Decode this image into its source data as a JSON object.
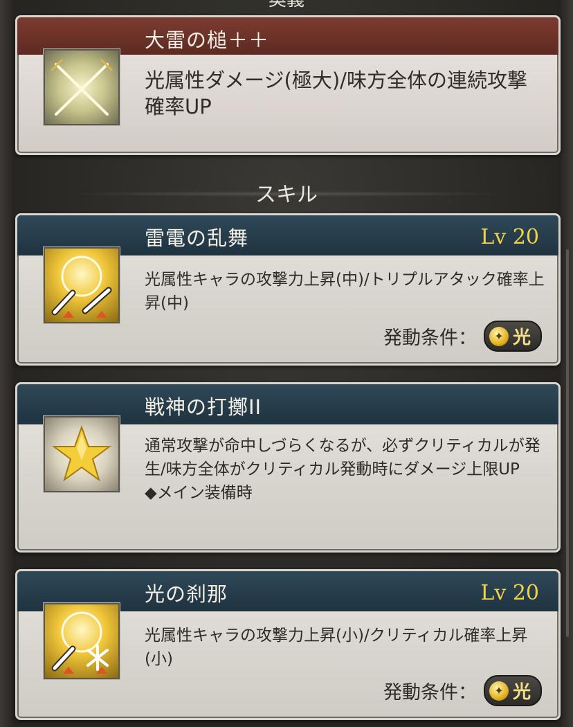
{
  "top_section_label": "奥義",
  "section_label": "スキル",
  "ougi": {
    "title": "大雷の槌＋＋",
    "description": "光属性ダメージ(極大)/味方全体の連続攻撃確率UP",
    "icon": "crossed-swords-icon"
  },
  "skills": [
    {
      "title": "雷電の乱舞",
      "level": "Lv 20",
      "description": "光属性キャラの攻撃力上昇(中)/トリプルアタック確率上昇(中)",
      "condition_label": "発動条件：",
      "condition_value": "光",
      "icon": "light-attack-up-icon"
    },
    {
      "title": "戦神の打擲II",
      "description": "通常攻撃が命中しづらくなるが、必ずクリティカルが発生/味方全体がクリティカル発動時にダメージ上限UP",
      "note": "◆メイン装備時",
      "icon": "star-icon"
    },
    {
      "title": "光の刹那",
      "level": "Lv 20",
      "description": "光属性キャラの攻撃力上昇(小)/クリティカル確率上昇(小)",
      "condition_label": "発動条件：",
      "condition_value": "光",
      "icon": "light-critical-up-icon"
    }
  ],
  "colors": {
    "ougi_banner": "#6e3329",
    "skill_banner": "#283e4c",
    "level_text": "#f1d347"
  }
}
